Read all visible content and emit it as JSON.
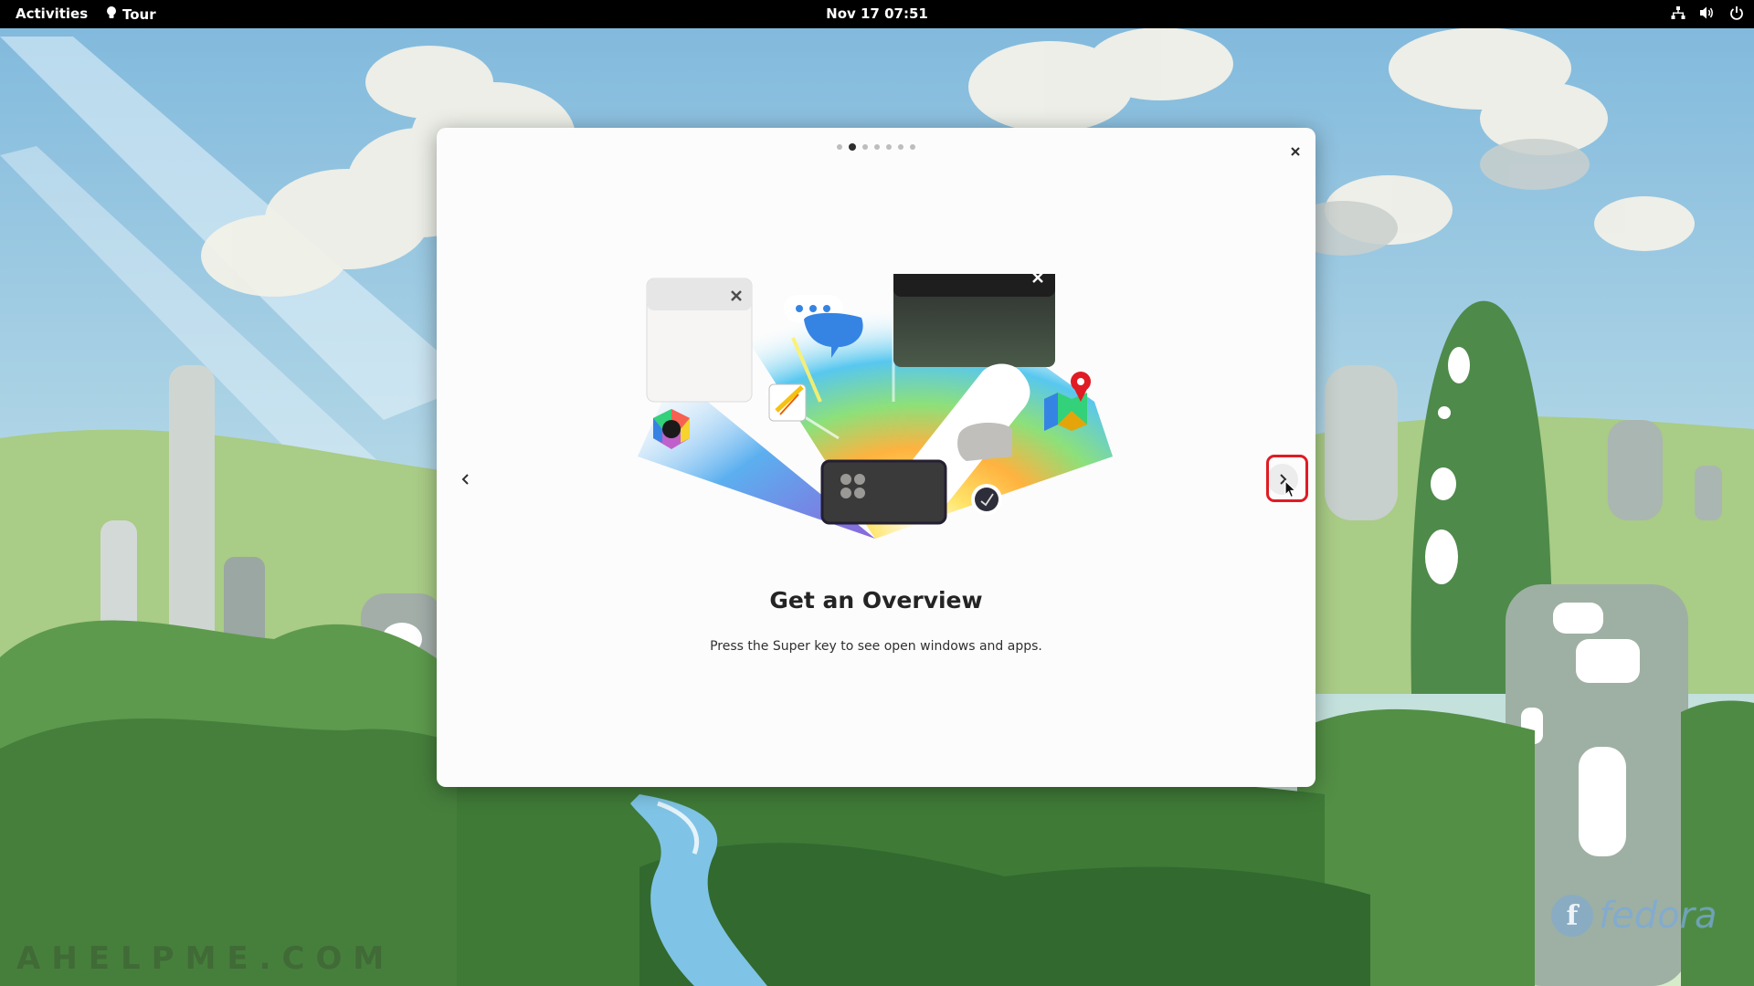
{
  "topbar": {
    "activities_label": "Activities",
    "app_name": "Tour",
    "clock": "Nov 17  07:51",
    "status_icons": [
      "network-wired-icon",
      "volume-icon",
      "power-icon"
    ]
  },
  "dialog": {
    "pagination": {
      "total": 7,
      "current": 2
    },
    "title": "Get an Overview",
    "description": "Press the Super key to see open windows and apps."
  },
  "wallpaper": {
    "watermark": "AHELPME.COM",
    "logo_text": "fedora"
  },
  "colors": {
    "topbar_bg": "#000000",
    "dialog_bg": "#fcfcfc",
    "highlight": "#e01b24",
    "dot_active": "#2e2e2e",
    "dot_inactive": "#bdbdbd"
  }
}
